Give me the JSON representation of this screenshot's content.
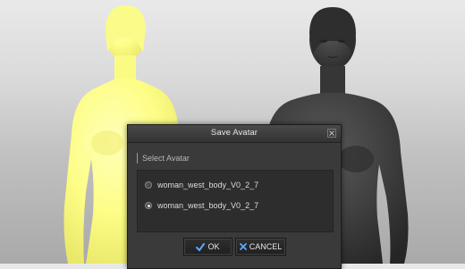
{
  "dialog": {
    "title": "Save Avatar",
    "section_label": "Select Avatar",
    "options": [
      {
        "label": "woman_west_body_V0_2_7",
        "selected": false
      },
      {
        "label": "woman_west_body_V0_2_7",
        "selected": true
      }
    ],
    "ok_label": "OK",
    "cancel_label": "CANCEL"
  },
  "icons": {
    "ok": "checkmark-icon",
    "cancel": "x-icon",
    "close": "close-icon"
  },
  "colors": {
    "selected_avatar": "#ffff8a",
    "other_avatar": "#3b3b3b",
    "ok_icon": "#5aa9ff",
    "cancel_icon": "#5aa9ff"
  }
}
